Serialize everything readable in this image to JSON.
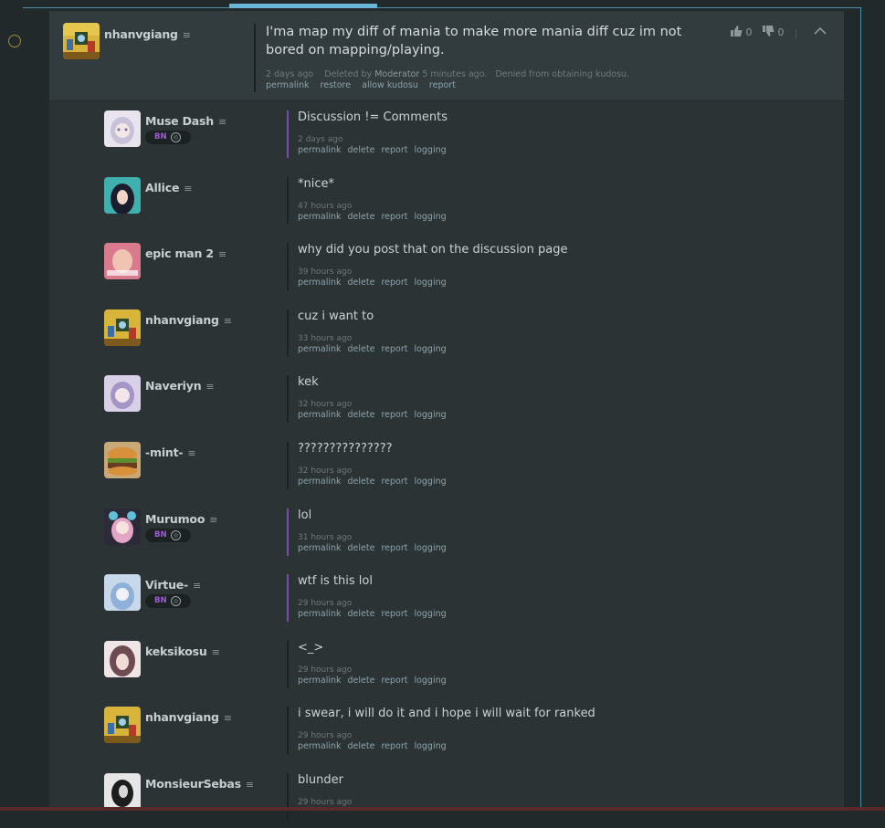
{
  "main_post": {
    "username": "nhanvgiang",
    "text": "I'ma map my diff of mania to make more mania diff cuz im not bored on mapping/playing.",
    "meta": {
      "time": "2 days ago",
      "deleted_prefix": "Deleted by",
      "deleted_by": "Moderator",
      "deleted_suffix": "5 minutes ago.",
      "kudosu": "Denied from obtaining kudosu."
    },
    "links": [
      "permalink",
      "restore",
      "allow kudosu",
      "report"
    ],
    "upvotes": "0",
    "downvotes": "0"
  },
  "badge_label": "BN",
  "reply_links": [
    "permalink",
    "delete",
    "report",
    "logging"
  ],
  "replies": [
    {
      "username": "Muse Dash",
      "bn": true,
      "text": "Discussion != Comments",
      "time": "2 days ago"
    },
    {
      "username": "Allice",
      "bn": false,
      "text": "*nice*",
      "time": "47 hours ago"
    },
    {
      "username": "epic man 2",
      "bn": false,
      "text": "why did you post that on the discussion page",
      "time": "39 hours ago"
    },
    {
      "username": "nhanvgiang",
      "bn": false,
      "text": "cuz i want to",
      "time": "33 hours ago"
    },
    {
      "username": "Naveriyn",
      "bn": false,
      "text": "kek",
      "time": "32 hours ago"
    },
    {
      "username": "-mint-",
      "bn": false,
      "text": "???????????????",
      "time": "32 hours ago"
    },
    {
      "username": "Murumoo",
      "bn": true,
      "text": "lol",
      "time": "31 hours ago"
    },
    {
      "username": "Virtue-",
      "bn": true,
      "text": "wtf is this lol",
      "time": "29 hours ago"
    },
    {
      "username": "keksikosu",
      "bn": false,
      "text": "<_>",
      "time": "29 hours ago"
    },
    {
      "username": "nhanvgiang",
      "bn": false,
      "text": "i swear, i will do it and i hope i will wait for ranked",
      "time": "29 hours ago"
    },
    {
      "username": "MonsieurSebas",
      "bn": false,
      "text": "blunder",
      "time": "29 hours ago"
    }
  ],
  "colors": {
    "background": "#22292b",
    "panel": "#2b3335",
    "header": "#323b3e",
    "accent_blue": "#69b6d8",
    "bn_purple": "#7a4bb0",
    "link": "#8fa3aa"
  }
}
